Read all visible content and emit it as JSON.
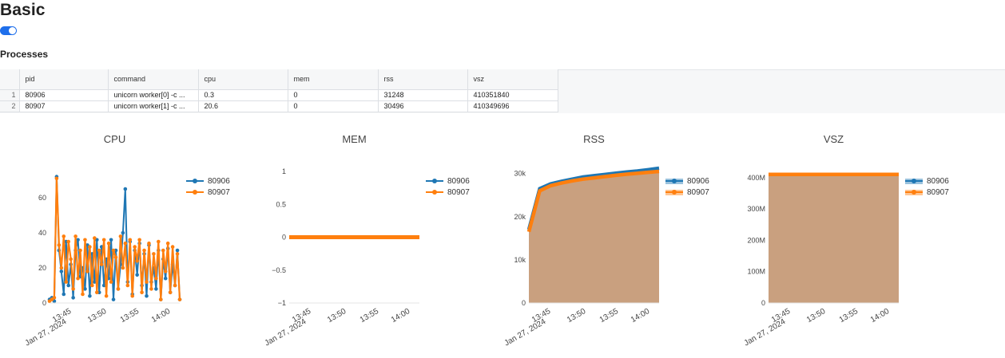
{
  "page": {
    "title": "Basic"
  },
  "toggle": {
    "on": true
  },
  "processes": {
    "title": "Processes",
    "columns": [
      "pid",
      "command",
      "cpu",
      "mem",
      "rss",
      "vsz"
    ],
    "rows": [
      {
        "index": "1",
        "pid": "80906",
        "command": "unicorn worker[0] -c ...",
        "cpu": "0.3",
        "mem": "0",
        "rss": "31248",
        "vsz": "410351840"
      },
      {
        "index": "2",
        "pid": "80907",
        "command": "unicorn worker[1] -c ...",
        "cpu": "20.6",
        "mem": "0",
        "rss": "30496",
        "vsz": "410349696"
      }
    ]
  },
  "colors": {
    "series_80906": "#1f77b4",
    "series_80907": "#ff7f0e",
    "fill_overlap": "#c9a07f"
  },
  "chart_data": [
    {
      "type": "line",
      "title": "CPU",
      "x_ticks": [
        "13:45",
        "13:50",
        "13:55",
        "14:00"
      ],
      "x_date_label": "Jan 27, 2024",
      "y_ticks": [
        "0",
        "20",
        "40",
        "60"
      ],
      "ylim": [
        0,
        75
      ],
      "legend_position": "top-right",
      "series": [
        {
          "name": "80906",
          "values": [
            2,
            3,
            1,
            72,
            30,
            18,
            5,
            35,
            10,
            22,
            3,
            30,
            36,
            15,
            20,
            8,
            33,
            4,
            28,
            12,
            36,
            6,
            32,
            10,
            25,
            14,
            36,
            2,
            30,
            8,
            22,
            40,
            65,
            12,
            35,
            5,
            30,
            16,
            34,
            10,
            28,
            4,
            33,
            12,
            20,
            8,
            30,
            2,
            25,
            14,
            31,
            6,
            22,
            10,
            30,
            2
          ]
        },
        {
          "name": "80907",
          "values": [
            1,
            2,
            3,
            71,
            33,
            20,
            38,
            12,
            35,
            25,
            8,
            38,
            14,
            30,
            5,
            36,
            18,
            32,
            10,
            37,
            6,
            30,
            22,
            36,
            4,
            34,
            12,
            30,
            26,
            8,
            38,
            20,
            34,
            10,
            36,
            4,
            32,
            24,
            36,
            6,
            30,
            12,
            34,
            8,
            28,
            14,
            35,
            2,
            30,
            18,
            34,
            6,
            32,
            10,
            28,
            2
          ]
        }
      ]
    },
    {
      "type": "line",
      "title": "MEM",
      "x_ticks": [
        "13:45",
        "13:50",
        "13:55",
        "14:00"
      ],
      "x_date_label": "Jan 27, 2024",
      "y_ticks": [
        "−1",
        "−0.5",
        "0",
        "0.5",
        "1"
      ],
      "ylim": [
        -1,
        1
      ],
      "legend_position": "top-right",
      "series": [
        {
          "name": "80906",
          "values": [
            0,
            0
          ]
        },
        {
          "name": "80907",
          "values": [
            0,
            0
          ]
        }
      ]
    },
    {
      "type": "area",
      "title": "RSS",
      "x_ticks": [
        "13:45",
        "13:50",
        "13:55",
        "14:00"
      ],
      "x_date_label": "Jan 27, 2024",
      "y_ticks": [
        "0",
        "10k",
        "20k",
        "30k"
      ],
      "ylim": [
        0,
        30500
      ],
      "legend_position": "top-right",
      "series": [
        {
          "name": "80906",
          "values": [
            17000,
            26500,
            27600,
            28200,
            28700,
            29200,
            29500,
            29800,
            30100,
            30350,
            30600,
            30900,
            31248
          ]
        },
        {
          "name": "80907",
          "values": [
            16500,
            26000,
            27200,
            27800,
            28300,
            28700,
            29000,
            29300,
            29600,
            29850,
            30050,
            30300,
            30496
          ]
        }
      ]
    },
    {
      "type": "area",
      "title": "VSZ",
      "x_ticks": [
        "13:45",
        "13:50",
        "13:55",
        "14:00"
      ],
      "x_date_label": "Jan 27, 2024",
      "y_ticks": [
        "0",
        "100M",
        "200M",
        "300M",
        "400M"
      ],
      "ylim": [
        0,
        420000000
      ],
      "legend_position": "top-right",
      "series": [
        {
          "name": "80906",
          "values": [
            410351840,
            410351840
          ]
        },
        {
          "name": "80907",
          "values": [
            410349696,
            410349696
          ]
        }
      ]
    }
  ]
}
